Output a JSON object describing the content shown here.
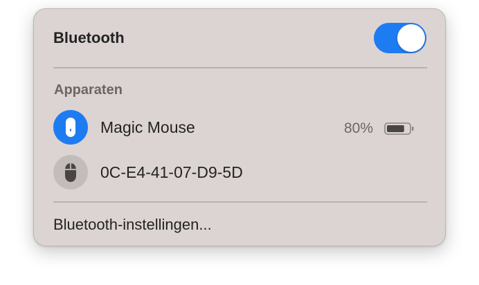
{
  "header": {
    "title": "Bluetooth",
    "toggle_state": "on",
    "accent_color": "#1e7cf2"
  },
  "devices_section": {
    "label": "Apparaten",
    "items": [
      {
        "name": "Magic Mouse",
        "battery": "80%",
        "battery_level": 0.8,
        "icon": "magic-mouse-icon",
        "connected": true
      },
      {
        "name": "0C-E4-41-07-D9-5D",
        "icon": "mouse-icon",
        "connected": false
      }
    ]
  },
  "footer": {
    "settings_label": "Bluetooth-instellingen..."
  }
}
